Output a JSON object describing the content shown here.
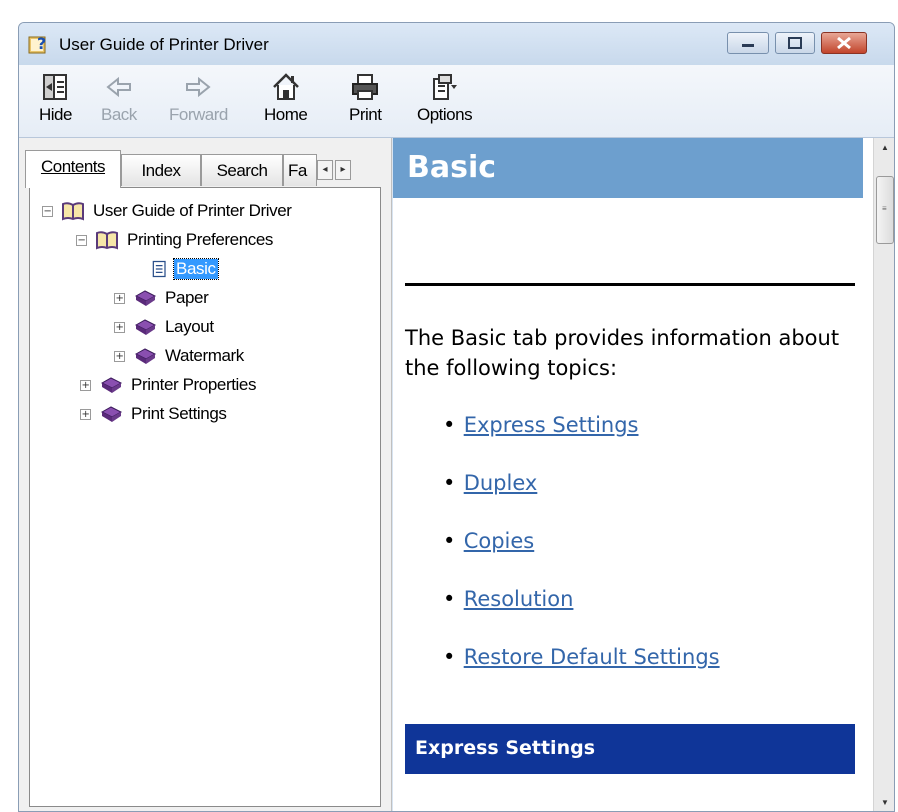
{
  "window": {
    "title": "User Guide of Printer Driver",
    "minimize_glyph": "–",
    "maximize_glyph": "▭",
    "close_glyph": "✕"
  },
  "toolbar": {
    "buttons": [
      {
        "label": "Hide",
        "icon": "hide-icon",
        "enabled": true
      },
      {
        "label": "Back",
        "icon": "back-arrow-icon",
        "enabled": false
      },
      {
        "label": "Forward",
        "icon": "forward-arrow-icon",
        "enabled": false
      },
      {
        "label": "Home",
        "icon": "home-icon",
        "enabled": true
      },
      {
        "label": "Print",
        "icon": "printer-icon",
        "enabled": true
      },
      {
        "label": "Options",
        "icon": "options-icon",
        "enabled": true
      }
    ]
  },
  "nav": {
    "tabs": [
      {
        "label": "Contents",
        "active": true
      },
      {
        "label": "Index",
        "active": false
      },
      {
        "label": "Search",
        "active": false
      },
      {
        "label": "Fa",
        "active": false
      }
    ],
    "tab_scroll_left": "◂",
    "tab_scroll_right": "▸",
    "tree": [
      {
        "label": "User Guide of Printer Driver",
        "expander": "−",
        "icon": "open-book-icon",
        "selected": false
      },
      {
        "label": "Printing Preferences",
        "expander": "−",
        "icon": "open-book-icon",
        "selected": false
      },
      {
        "label": "Basic",
        "expander": "",
        "icon": "page-icon",
        "selected": true
      },
      {
        "label": "Paper",
        "expander": "+",
        "icon": "closed-book-icon",
        "selected": false
      },
      {
        "label": "Layout",
        "expander": "+",
        "icon": "closed-book-icon",
        "selected": false
      },
      {
        "label": "Watermark",
        "expander": "+",
        "icon": "closed-book-icon",
        "selected": false
      },
      {
        "label": "Printer Properties",
        "expander": "+",
        "icon": "closed-book-icon",
        "selected": false
      },
      {
        "label": "Print Settings",
        "expander": "+",
        "icon": "closed-book-icon",
        "selected": false
      }
    ]
  },
  "content": {
    "title": "Basic",
    "intro": "The Basic tab provides information about the following topics:",
    "bullet": "•",
    "links": [
      "Express Settings",
      "Duplex",
      "Copies",
      "Resolution",
      "Restore Default Settings"
    ],
    "section_title": "Express Settings"
  },
  "scrollbar": {
    "up": "▲",
    "down": "▼",
    "grip": "≡"
  },
  "colors": {
    "header_bar": "#6d9fce",
    "section_bar": "#0f3598",
    "link": "#3366aa",
    "selection": "#3399ff"
  }
}
